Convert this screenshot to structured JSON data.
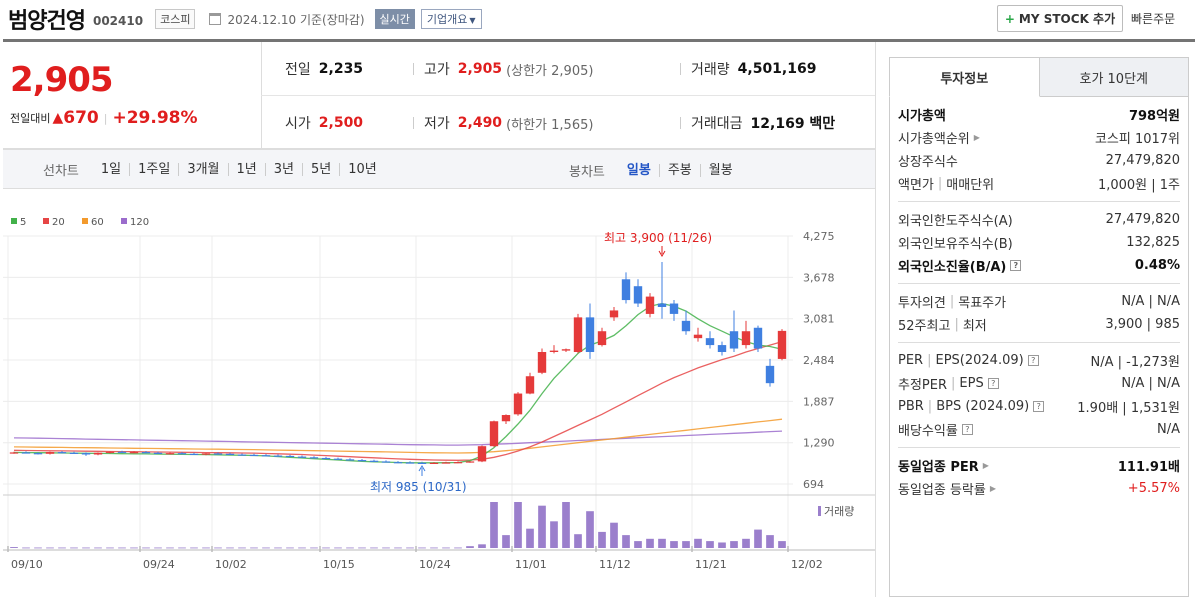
{
  "header": {
    "name": "범양건영",
    "code": "002410",
    "market": "코스피",
    "date_text": "2024.12.10  기준(장마감)",
    "realtime_label": "실시간",
    "corp_label": "기업개요",
    "mystock_label": "MY STOCK 추가",
    "quick_order_label": "빠른주문"
  },
  "price": {
    "current": "2,905",
    "diff_label": "전일대비",
    "diff_value": "670",
    "diff_sep": "|",
    "diff_rate": "+29.98%",
    "prev_label": "전일",
    "prev_value": "2,235",
    "high_label": "고가",
    "high_value": "2,905",
    "high_sub": "(상한가 2,905)",
    "volume_label": "거래량",
    "volume_value": "4,501,169",
    "open_label": "시가",
    "open_value": "2,500",
    "low_label": "저가",
    "low_value": "2,490",
    "low_sub": "(하한가 1,565)",
    "amount_label": "거래대금",
    "amount_value": "12,169 백만"
  },
  "period": {
    "line_label": "선차트",
    "line_items": [
      "1일",
      "1주일",
      "3개월",
      "1년",
      "3년",
      "5년",
      "10년"
    ],
    "candle_label": "봉차트",
    "candle_items": [
      "일봉",
      "주봉",
      "월봉"
    ],
    "candle_selected": 0
  },
  "chart_data": {
    "type": "candlestick",
    "legend": [
      "5",
      "20",
      "60",
      "120"
    ],
    "legend_colors": [
      "#42b14a",
      "#e64545",
      "#f39a2c",
      "#9b6ccc"
    ],
    "y_ticks": [
      "4,275",
      "3,678",
      "3,081",
      "2,484",
      "1,887",
      "1,290",
      "694"
    ],
    "y_values": [
      4275,
      3678,
      3081,
      2484,
      1887,
      1290,
      694
    ],
    "x_ticks": [
      "09/10",
      "09/24",
      "10/02",
      "10/15",
      "10/24",
      "11/01",
      "11/12",
      "11/21",
      "12/02"
    ],
    "max_note": "최고 3,900 (11/26)",
    "min_note": "최저 985 (10/31)",
    "volume_label": "거래량",
    "candles": [
      [
        1145,
        1160,
        1130,
        1150
      ],
      [
        1150,
        1165,
        1135,
        1140
      ],
      [
        1140,
        1150,
        1120,
        1130
      ],
      [
        1130,
        1160,
        1120,
        1155
      ],
      [
        1155,
        1170,
        1140,
        1145
      ],
      [
        1145,
        1160,
        1130,
        1140
      ],
      [
        1140,
        1150,
        1100,
        1120
      ],
      [
        1120,
        1150,
        1110,
        1145
      ],
      [
        1145,
        1165,
        1135,
        1160
      ],
      [
        1160,
        1175,
        1145,
        1150
      ],
      [
        1150,
        1165,
        1140,
        1155
      ],
      [
        1155,
        1170,
        1140,
        1145
      ],
      [
        1145,
        1160,
        1130,
        1135
      ],
      [
        1135,
        1150,
        1120,
        1140
      ],
      [
        1140,
        1155,
        1125,
        1130
      ],
      [
        1130,
        1145,
        1115,
        1125
      ],
      [
        1125,
        1140,
        1110,
        1135
      ],
      [
        1135,
        1150,
        1120,
        1130
      ],
      [
        1130,
        1145,
        1115,
        1120
      ],
      [
        1120,
        1135,
        1105,
        1115
      ],
      [
        1115,
        1130,
        1100,
        1110
      ],
      [
        1110,
        1125,
        1095,
        1105
      ],
      [
        1105,
        1120,
        1090,
        1100
      ],
      [
        1100,
        1115,
        1085,
        1090
      ],
      [
        1090,
        1105,
        1075,
        1080
      ],
      [
        1080,
        1095,
        1065,
        1070
      ],
      [
        1070,
        1085,
        1055,
        1060
      ],
      [
        1060,
        1075,
        1045,
        1050
      ],
      [
        1050,
        1065,
        1035,
        1040
      ],
      [
        1040,
        1055,
        1025,
        1030
      ],
      [
        1030,
        1045,
        1015,
        1020
      ],
      [
        1020,
        1035,
        1005,
        1010
      ],
      [
        1010,
        1025,
        995,
        1005
      ],
      [
        1005,
        1020,
        990,
        1000
      ],
      [
        1000,
        1015,
        985,
        995
      ],
      [
        995,
        1010,
        985,
        1000
      ],
      [
        1000,
        1015,
        990,
        1005
      ],
      [
        1005,
        1020,
        995,
        1010
      ],
      [
        1010,
        1025,
        1000,
        1020
      ],
      [
        1020,
        1250,
        1010,
        1240
      ],
      [
        1240,
        1610,
        1230,
        1600
      ],
      [
        1600,
        1700,
        1560,
        1690
      ],
      [
        1700,
        2020,
        1680,
        2000
      ],
      [
        2000,
        2300,
        1990,
        2250
      ],
      [
        2300,
        2650,
        2280,
        2600
      ],
      [
        2600,
        2700,
        2580,
        2620
      ],
      [
        2620,
        2650,
        2600,
        2640
      ],
      [
        2600,
        3150,
        2580,
        3100
      ],
      [
        3100,
        3300,
        2500,
        2600
      ],
      [
        2700,
        2950,
        2680,
        2900
      ],
      [
        3100,
        3250,
        3050,
        3200
      ],
      [
        3650,
        3750,
        3300,
        3350
      ],
      [
        3550,
        3650,
        3250,
        3300
      ],
      [
        3150,
        3450,
        3100,
        3400
      ],
      [
        3300,
        3900,
        3080,
        3250
      ],
      [
        3300,
        3350,
        3050,
        3150
      ],
      [
        3050,
        3200,
        2850,
        2900
      ],
      [
        2800,
        2950,
        2750,
        2850
      ],
      [
        2800,
        2900,
        2650,
        2700
      ],
      [
        2700,
        2750,
        2550,
        2600
      ],
      [
        2900,
        3200,
        2600,
        2650
      ],
      [
        2700,
        3050,
        2650,
        2900
      ],
      [
        2950,
        2980,
        2600,
        2650
      ],
      [
        2400,
        2500,
        2100,
        2150
      ],
      [
        2500,
        2930,
        2480,
        2905
      ]
    ],
    "volumes": [
      2,
      1,
      1,
      1,
      1,
      1,
      1,
      1,
      1,
      1,
      1,
      1,
      1,
      1,
      1,
      1,
      1,
      1,
      1,
      1,
      1,
      1,
      1,
      1,
      1,
      1,
      1,
      1,
      1,
      1,
      1,
      1,
      1,
      1,
      1,
      1,
      1,
      1,
      4,
      8,
      100,
      28,
      100,
      42,
      92,
      58,
      100,
      30,
      80,
      35,
      55,
      28,
      15,
      20,
      20,
      15,
      15,
      20,
      15,
      12,
      15,
      20,
      40,
      28,
      15
    ],
    "ma5": [
      1150,
      1148,
      1146,
      1144,
      1142,
      1140,
      1138,
      1136,
      1134,
      1132,
      1130,
      1128,
      1126,
      1124,
      1122,
      1120,
      1118,
      1115,
      1112,
      1110,
      1105,
      1100,
      1090,
      1080,
      1070,
      1060,
      1050,
      1040,
      1030,
      1020,
      1015,
      1010,
      1005,
      1000,
      1000,
      1000,
      1002,
      1005,
      1030,
      1100,
      1220,
      1380,
      1560,
      1760,
      2000,
      2220,
      2400,
      2580,
      2700,
      2760,
      2840,
      2980,
      3140,
      3260,
      3300,
      3260,
      3190,
      3080,
      2980,
      2900,
      2820,
      2750,
      2700,
      2680,
      2640
    ],
    "ma20": [
      1180,
      1178,
      1176,
      1174,
      1172,
      1170,
      1168,
      1166,
      1164,
      1162,
      1160,
      1158,
      1156,
      1154,
      1152,
      1150,
      1148,
      1146,
      1144,
      1142,
      1140,
      1135,
      1130,
      1125,
      1120,
      1112,
      1104,
      1096,
      1088,
      1080,
      1072,
      1064,
      1056,
      1050,
      1045,
      1040,
      1038,
      1036,
      1040,
      1050,
      1080,
      1120,
      1170,
      1230,
      1300,
      1380,
      1460,
      1540,
      1620,
      1700,
      1790,
      1880,
      1970,
      2060,
      2150,
      2230,
      2300,
      2370,
      2430,
      2490,
      2540,
      2600,
      2650,
      2700,
      2750
    ],
    "ma60": [
      1230,
      1228,
      1226,
      1224,
      1222,
      1220,
      1218,
      1216,
      1214,
      1212,
      1210,
      1208,
      1206,
      1204,
      1202,
      1200,
      1198,
      1196,
      1194,
      1192,
      1190,
      1187,
      1184,
      1181,
      1178,
      1175,
      1172,
      1169,
      1166,
      1163,
      1160,
      1157,
      1154,
      1151,
      1148,
      1145,
      1143,
      1142,
      1145,
      1150,
      1160,
      1175,
      1190,
      1210,
      1230,
      1250,
      1270,
      1290,
      1310,
      1330,
      1350,
      1370,
      1390,
      1410,
      1430,
      1450,
      1470,
      1490,
      1510,
      1530,
      1550,
      1570,
      1590,
      1610,
      1630
    ],
    "ma120": [
      1360,
      1358,
      1355,
      1352,
      1349,
      1346,
      1343,
      1340,
      1337,
      1334,
      1331,
      1328,
      1325,
      1322,
      1319,
      1316,
      1313,
      1310,
      1307,
      1304,
      1301,
      1298,
      1295,
      1292,
      1289,
      1286,
      1283,
      1280,
      1277,
      1274,
      1271,
      1268,
      1265,
      1262,
      1260,
      1258,
      1256,
      1256,
      1258,
      1262,
      1268,
      1275,
      1282,
      1290,
      1298,
      1306,
      1314,
      1322,
      1330,
      1338,
      1346,
      1354,
      1362,
      1370,
      1378,
      1386,
      1394,
      1402,
      1410,
      1418,
      1426,
      1434,
      1442,
      1450,
      1458
    ]
  },
  "side": {
    "tab_active": "투자정보",
    "tab_inactive": "호가 10단계",
    "g1": [
      {
        "k": "시가총액",
        "v": "798억원",
        "kb": true,
        "vb": true
      },
      {
        "k": "시가총액순위",
        "v": "코스피 1017위",
        "caret": true
      },
      {
        "k": "상장주식수",
        "v": "27,479,820"
      },
      {
        "k": "액면가",
        "k2": "매매단위",
        "v": "1,000원",
        "v2": "1주"
      }
    ],
    "g2": [
      {
        "k": "외국인한도주식수(A)",
        "v": "27,479,820"
      },
      {
        "k": "외국인보유주식수(B)",
        "v": "132,825"
      },
      {
        "k": "외국인소진율(B/A)",
        "v": "0.48%",
        "kb": true,
        "vb": true,
        "help": true
      }
    ],
    "g3": [
      {
        "k": "투자의견",
        "k2": "목표주가",
        "v": "N/A",
        "v2": "N/A"
      },
      {
        "k": "52주최고",
        "k2": "최저",
        "v": "3,900",
        "v2": "985"
      }
    ],
    "g4": [
      {
        "k": "PER",
        "k2": "EPS(2024.09)",
        "v": "N/A",
        "v2": "-1,273원",
        "help": true
      },
      {
        "k": "추정PER",
        "k2": "EPS",
        "v": "N/A",
        "v2": "N/A",
        "help": true
      },
      {
        "k": "PBR",
        "k2": "BPS (2024.09)",
        "v": "1.90배",
        "v2": "1,531원",
        "help": true
      },
      {
        "k": "배당수익률",
        "v": "N/A",
        "help": true
      }
    ],
    "g5": [
      {
        "k": "동일업종 PER",
        "v": "111.91배",
        "kb": true,
        "vb": true,
        "caret": true
      },
      {
        "k": "동일업종 등락률",
        "v": "+5.57%",
        "caret": true,
        "vred": true
      }
    ]
  }
}
